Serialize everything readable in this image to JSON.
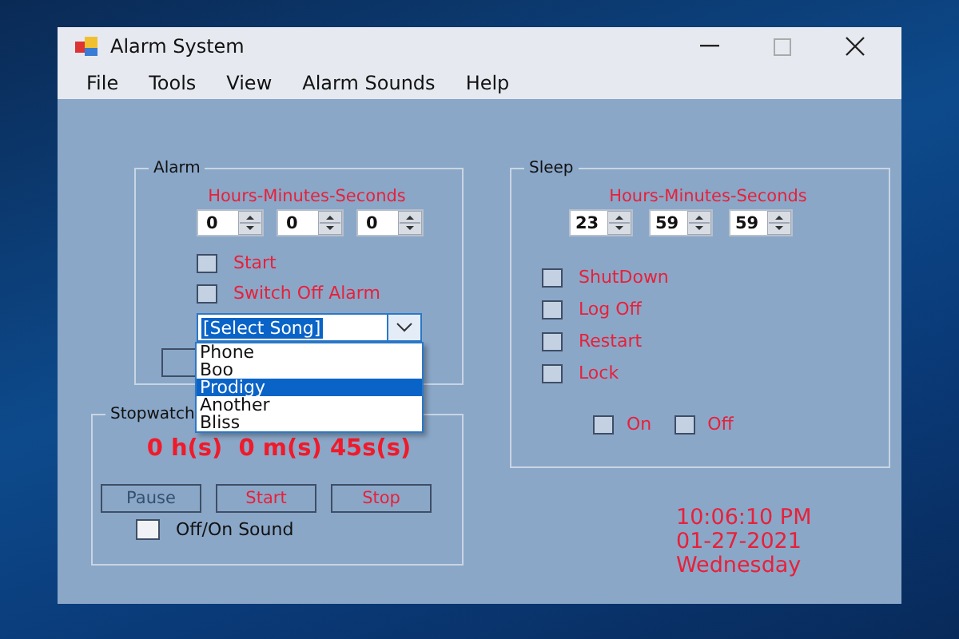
{
  "window": {
    "title": "Alarm System"
  },
  "menu": [
    {
      "label": "File"
    },
    {
      "label": "Tools"
    },
    {
      "label": "View"
    },
    {
      "label": "Alarm Sounds"
    },
    {
      "label": "Help"
    }
  ],
  "alarm": {
    "title": "Alarm",
    "time_label": "Hours-Minutes-Seconds",
    "spinners": [
      {
        "value": "0"
      },
      {
        "value": "0"
      },
      {
        "value": "0"
      }
    ],
    "checkboxes": [
      {
        "label": "Start",
        "checked": false
      },
      {
        "label": "Switch Off Alarm",
        "checked": false
      }
    ],
    "song_combo": {
      "value": "[Select Song]",
      "expanded": true,
      "options": [
        {
          "label": "Phone",
          "selected": false
        },
        {
          "label": "Boo",
          "selected": false
        },
        {
          "label": "Prodigy",
          "selected": true
        },
        {
          "label": "Another",
          "selected": false
        },
        {
          "label": "Bliss",
          "selected": false
        }
      ]
    }
  },
  "sleep": {
    "title": "Sleep",
    "time_label": "Hours-Minutes-Seconds",
    "spinners": [
      {
        "value": "23"
      },
      {
        "value": "59"
      },
      {
        "value": "59"
      }
    ],
    "actions": [
      {
        "label": "ShutDown",
        "checked": false
      },
      {
        "label": "Log Off",
        "checked": false
      },
      {
        "label": "Restart",
        "checked": false
      },
      {
        "label": "Lock",
        "checked": false
      }
    ],
    "toggles": [
      {
        "label": "On",
        "checked": false
      },
      {
        "label": "Off",
        "checked": false
      }
    ]
  },
  "stopwatch": {
    "title": "Stopwatch",
    "display": "0 h(s)  0 m(s) 45s(s)",
    "buttons": [
      {
        "label": "Pause",
        "kind": "plain"
      },
      {
        "label": "Start",
        "kind": "red"
      },
      {
        "label": "Stop",
        "kind": "red"
      }
    ],
    "sound_checkbox": {
      "label": "Off/On Sound",
      "checked": false
    }
  },
  "clock": {
    "time": "10:06:10 PM",
    "date": "01-27-2021",
    "day": "Wednesday"
  }
}
